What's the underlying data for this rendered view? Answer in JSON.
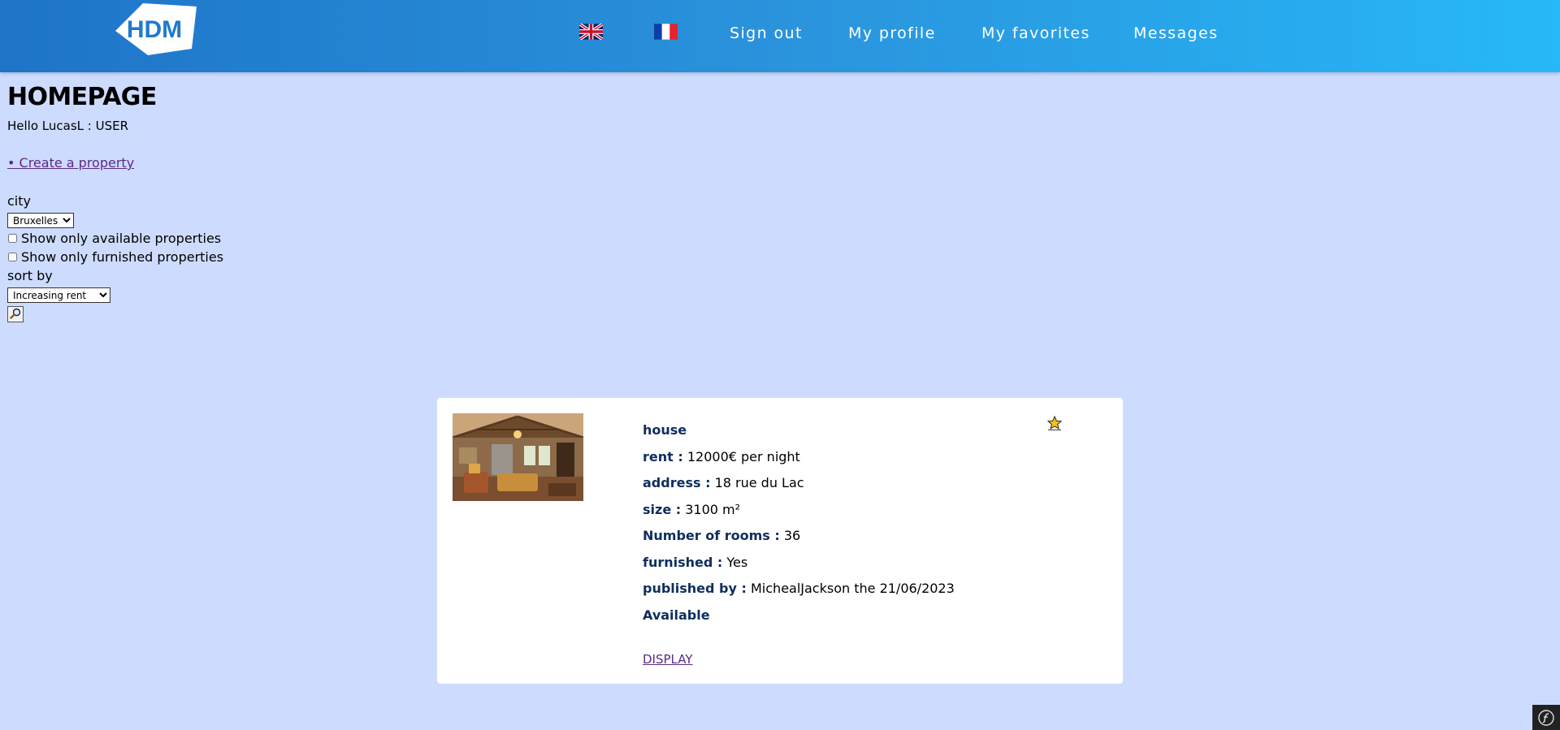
{
  "header": {
    "logo_text": "HDM",
    "flag_english": "uk-flag-icon",
    "flag_french": "france-flag-icon",
    "nav": {
      "sign_out": "Sign out",
      "my_profile": "My profile",
      "my_favorites": "My favorites",
      "messages": "Messages"
    }
  },
  "page": {
    "title": "HOMEPAGE",
    "greeting": "Hello LucasL : USER",
    "create_link": "• Create a property"
  },
  "filters": {
    "city_label": "city",
    "city_value": "Bruxelles",
    "available_label": "Show only available properties",
    "available_checked": false,
    "furnished_label": "Show only furnished properties",
    "furnished_checked": false,
    "sort_label": "sort by",
    "sort_value": "Increasing rent",
    "search_icon": "magnifier-icon"
  },
  "property": {
    "type": "house",
    "rent_label": "rent :",
    "rent_value": "12000€ per night",
    "address_label": "address :",
    "address_value": "18 rue du Lac",
    "size_label": "size :",
    "size_value": "3100 m²",
    "rooms_label": "Number of rooms :",
    "rooms_value": "36",
    "furnished_label": "furnished :",
    "furnished_value": "Yes",
    "published_label": "published by :",
    "published_value": "MichealJackson the 21/06/2023",
    "availability": "Available",
    "display_link": "DISPLAY",
    "favorite_icon": "star-icon"
  },
  "colors": {
    "header_start": "#1e74c8",
    "header_end": "#27b8f8",
    "page_background": "#cddcfe",
    "link": "#5b2a86",
    "label": "#0e2e5e",
    "star": "#f6c31a"
  }
}
